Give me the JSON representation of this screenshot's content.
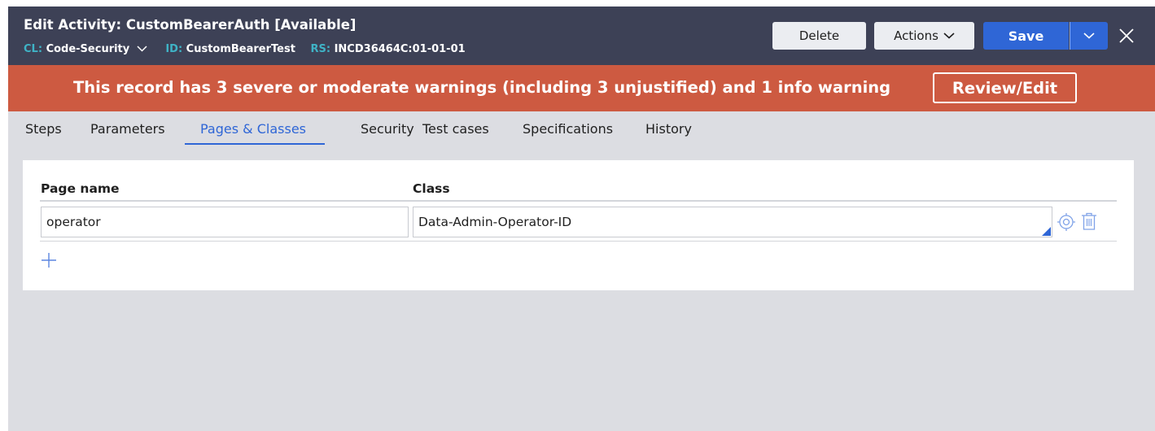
{
  "header": {
    "title": "Edit  Activity: CustomBearerAuth [Available]",
    "cl_label": "CL:",
    "cl_value": "Code-Security",
    "id_label": "ID:",
    "id_value": "CustomBearerTest",
    "rs_label": "RS:",
    "rs_value": "INCD36464C:01-01-01",
    "delete_label": "Delete",
    "actions_label": "Actions",
    "save_label": "Save"
  },
  "banner": {
    "message": "This record has 3 severe or moderate warnings (including 3 unjustified) and 1 info warning",
    "review_label": "Review/Edit"
  },
  "tabs": [
    {
      "label": "Steps"
    },
    {
      "label": "Parameters"
    },
    {
      "label": "Pages & Classes",
      "active": true
    },
    {
      "label": "Security"
    },
    {
      "label": "Test cases"
    },
    {
      "label": "Specifications"
    },
    {
      "label": "History"
    }
  ],
  "table": {
    "columns": [
      "Page name",
      "Class"
    ],
    "rows": [
      {
        "page_name": "operator",
        "class": "Data-Admin-Operator-ID"
      }
    ]
  },
  "colors": {
    "header_bg": "#3d4156",
    "banner_bg": "#cd5a41",
    "accent": "#2f66d6",
    "label_teal": "#3fb3c6"
  },
  "icons": [
    "chevron-down-icon",
    "close-icon",
    "target-icon",
    "trash-icon",
    "plus-icon"
  ]
}
